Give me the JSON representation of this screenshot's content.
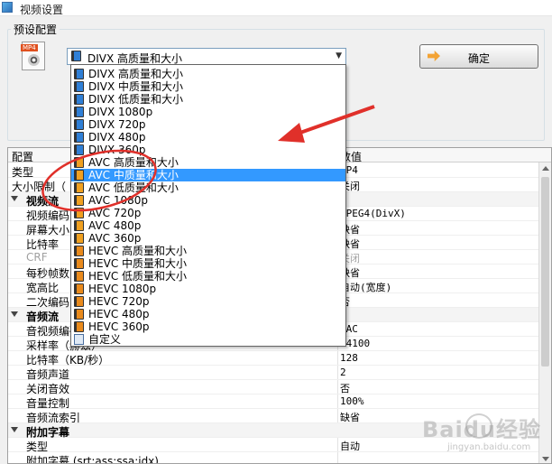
{
  "window": {
    "title": "视频设置"
  },
  "preset": {
    "group_label": "预设配置",
    "file_badge": "MP4",
    "selected_value": "DIVX 高质量和大小",
    "ok_label": "确定"
  },
  "dropdown": {
    "items": [
      {
        "label": "DIVX 高质量和大小",
        "icon": "divx"
      },
      {
        "label": "DIVX 中质量和大小",
        "icon": "divx"
      },
      {
        "label": "DIVX 低质量和大小",
        "icon": "divx"
      },
      {
        "label": "DIVX 1080p",
        "icon": "divx"
      },
      {
        "label": "DIVX 720p",
        "icon": "divx"
      },
      {
        "label": "DIVX 480p",
        "icon": "divx"
      },
      {
        "label": "DIVX 360p",
        "icon": "divx"
      },
      {
        "label": "AVC 高质量和大小",
        "icon": "avc"
      },
      {
        "label": "AVC 中质量和大小",
        "icon": "avc",
        "selected": true
      },
      {
        "label": "AVC 低质量和大小",
        "icon": "avc"
      },
      {
        "label": "AVC 1080p",
        "icon": "avc"
      },
      {
        "label": "AVC 720p",
        "icon": "avc"
      },
      {
        "label": "AVC 480p",
        "icon": "avc"
      },
      {
        "label": "AVC 360p",
        "icon": "avc"
      },
      {
        "label": "HEVC 高质量和大小",
        "icon": "hevc"
      },
      {
        "label": "HEVC 中质量和大小",
        "icon": "hevc"
      },
      {
        "label": "HEVC 低质量和大小",
        "icon": "hevc"
      },
      {
        "label": "HEVC 1080p",
        "icon": "hevc"
      },
      {
        "label": "HEVC 720p",
        "icon": "hevc"
      },
      {
        "label": "HEVC 480p",
        "icon": "hevc"
      },
      {
        "label": "HEVC 360p",
        "icon": "hevc"
      },
      {
        "label": "自定义",
        "icon": "custom"
      }
    ]
  },
  "grid": {
    "col_config": "配置",
    "col_value": "数值",
    "rows": [
      {
        "key": "类型",
        "value": "MP4",
        "indent": 0
      },
      {
        "key": "大小限制（",
        "value": "关闭",
        "indent": 0
      },
      {
        "key": "视频流",
        "value": "",
        "section": true
      },
      {
        "key": "视频编码",
        "value": "MPEG4(DivX)",
        "indent": 1
      },
      {
        "key": "屏幕大小",
        "value": "缺省",
        "indent": 1
      },
      {
        "key": "比特率",
        "value": "缺省",
        "indent": 1
      },
      {
        "key": "CRF",
        "value": "关闭",
        "indent": 1,
        "disabled": true
      },
      {
        "key": "每秒帧数",
        "value": "缺省",
        "indent": 1
      },
      {
        "key": "宽高比",
        "value": "自动(宽度)",
        "indent": 1
      },
      {
        "key": "二次编码",
        "value": "否",
        "indent": 1
      },
      {
        "key": "音频流",
        "value": "",
        "section": true
      },
      {
        "key": "音视频编码",
        "value": "AAC",
        "indent": 1
      },
      {
        "key": "采样率（赫兹）",
        "value": "44100",
        "indent": 1
      },
      {
        "key": "比特率（KB/秒）",
        "value": "128",
        "indent": 1
      },
      {
        "key": "音频声道",
        "value": "2",
        "indent": 1
      },
      {
        "key": "关闭音效",
        "value": "否",
        "indent": 1
      },
      {
        "key": "音量控制",
        "value": "100%",
        "indent": 1
      },
      {
        "key": "音频流索引",
        "value": "缺省",
        "indent": 1
      },
      {
        "key": "附加字幕",
        "value": "",
        "section": true
      },
      {
        "key": "类型",
        "value": "自动",
        "indent": 1
      },
      {
        "key": "附加字幕 (srt;ass;ssa;idx)",
        "value": "",
        "indent": 1
      }
    ]
  },
  "watermark": {
    "text": "Baidu经验",
    "sub": "jingyan.baidu.com"
  },
  "colors": {
    "annotation_red": "#e0302a",
    "selection_blue": "#3399ff"
  }
}
